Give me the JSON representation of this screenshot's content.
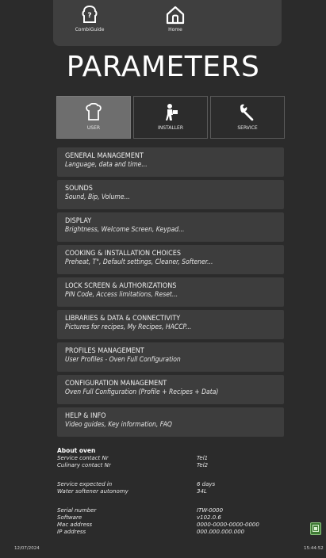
{
  "nav": {
    "combiguide_label": "CombiGuide",
    "home_label": "Home"
  },
  "page_title": "PARAMETERS",
  "roles": [
    {
      "label": "USER",
      "icon": "chef-hat-icon",
      "active": true
    },
    {
      "label": "INSTALLER",
      "icon": "installer-icon",
      "active": false
    },
    {
      "label": "SERVICE",
      "icon": "wrench-icon",
      "active": false
    }
  ],
  "menu": [
    {
      "title": "GENERAL MANAGEMENT",
      "subtitle": "Language, data and time..."
    },
    {
      "title": "SOUNDS",
      "subtitle": "Sound, Bip, Volume..."
    },
    {
      "title": "DISPLAY",
      "subtitle": "Brightness, Welcome Screen, Keypad..."
    },
    {
      "title": "COOKING & INSTALLATION CHOICES",
      "subtitle": "Preheat, T°, Default settings, Cleaner, Softener..."
    },
    {
      "title": "LOCK SCREEN & AUTHORIZATIONS",
      "subtitle": "PIN Code, Access limitations, Reset..."
    },
    {
      "title": "LIBRARIES & DATA & CONNECTIVITY",
      "subtitle": "Pictures for recipes, My Recipes, HACCP..."
    },
    {
      "title": "PROFILES MANAGEMENT",
      "subtitle": "User Profiles - Oven Full Configuration"
    },
    {
      "title": "CONFIGURATION MANAGEMENT",
      "subtitle": "Oven Full Configuration (Profile + Recipes + Data)"
    },
    {
      "title": "HELP & INFO",
      "subtitle": "Video guides, Key information, FAQ"
    }
  ],
  "about": {
    "title": "About oven",
    "rows": [
      {
        "label": "Service contact Nr",
        "value": "Tel1"
      },
      {
        "label": "Culinary contact Nr",
        "value": "Tel2"
      },
      {
        "label": "Service expected in",
        "value": "6 days"
      },
      {
        "label": "Water softener autonomy",
        "value": "34L"
      },
      {
        "label": "Serial number",
        "value": "ITW-0000"
      },
      {
        "label": "Software",
        "value": "v102.0.6"
      },
      {
        "label": "Mac address",
        "value": "0000-0000-0000-0000"
      },
      {
        "label": "IP address",
        "value": "000.000.000.000"
      }
    ]
  },
  "status": {
    "date": "12/07/2024",
    "time": "15:44:52",
    "indicator_color": "#3f7a34"
  },
  "colors": {
    "background": "#2b2b2b",
    "panel": "#3d3d3d",
    "active_tab": "#6e6e6e"
  }
}
